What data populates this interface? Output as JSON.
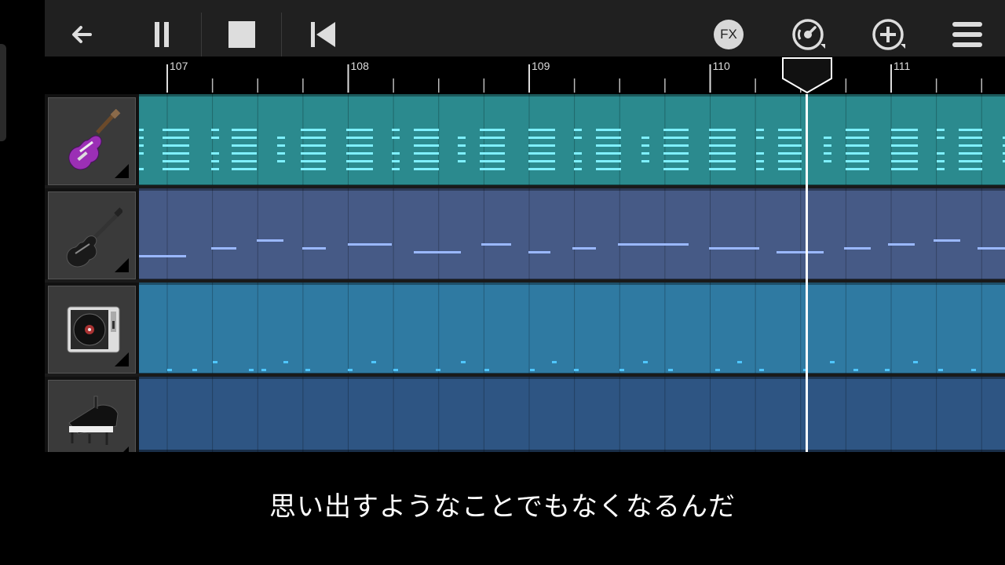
{
  "toolbar": {
    "buttons": [
      {
        "name": "back-arrow-icon"
      },
      {
        "name": "pause-icon"
      },
      {
        "name": "stop-icon"
      },
      {
        "name": "skip-to-start-icon"
      },
      {
        "name": "fx-icon",
        "label": "FX"
      },
      {
        "name": "tempo-dial-icon"
      },
      {
        "name": "add-track-icon"
      },
      {
        "name": "menu-icon"
      }
    ]
  },
  "ruler": {
    "bars": [
      "107",
      "108",
      "109",
      "110",
      "111"
    ]
  },
  "tracks": [
    {
      "instrument": "electric-guitar",
      "color": "#2b8a8e",
      "note_color": "#7ff0ff"
    },
    {
      "instrument": "bass-guitar",
      "color": "#465a86",
      "note_color": "#9ab8ff"
    },
    {
      "instrument": "dj-turntable",
      "color": "#2f7aa2",
      "note_color": "#4fc6ff"
    },
    {
      "instrument": "grand-piano",
      "color": "#2e5583",
      "note_color": "#7fb2ff"
    }
  ],
  "subtitle": "思い出すようなことでもなくなるんだ",
  "colors": {
    "toolbar_bg": "#202020",
    "ruler_bg": "#000000",
    "grid_line": "#1e4a5a",
    "playhead": "#ffffff"
  }
}
